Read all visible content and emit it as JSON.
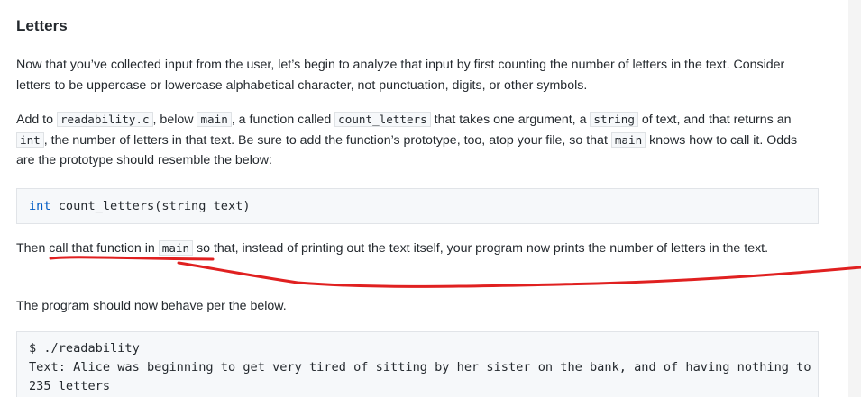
{
  "heading": "Letters",
  "para1": "Now that you’ve collected input from the user, let’s begin to analyze that input by first counting the number of letters in the text. Consider letters to be uppercase or lowercase alphabetical character, not punctuation, digits, or other symbols.",
  "para2": {
    "t1": "Add to ",
    "c1": "readability.c",
    "t2": ", below ",
    "c2": "main",
    "t3": ", a function called ",
    "c3": "count_letters",
    "t4": " that takes one argument, a ",
    "c4": "string",
    "t5": " of text, and that returns an ",
    "c5": "int",
    "t6": ", the number of letters in that text. Be sure to add the function’s prototype, too, atop your file, so that ",
    "c6": "main",
    "t7": " knows how to call it. Odds are the prototype should resemble the below:"
  },
  "code1": {
    "keyword": "int",
    "rest": " count_letters(string text)"
  },
  "para3": {
    "t1": "Then call that function in ",
    "c1": "main",
    "t2": " so that, instead of printing out the text itself, your program now prints the number of letters in the text."
  },
  "para4": "The program should now behave per the below.",
  "code2": {
    "line1": "$ ./readability",
    "line2": "Text: Alice was beginning to get very tired of sitting by her sister on the bank, and of having nothing to do",
    "line3": "235 letters"
  },
  "annotation_color": "#e02020"
}
